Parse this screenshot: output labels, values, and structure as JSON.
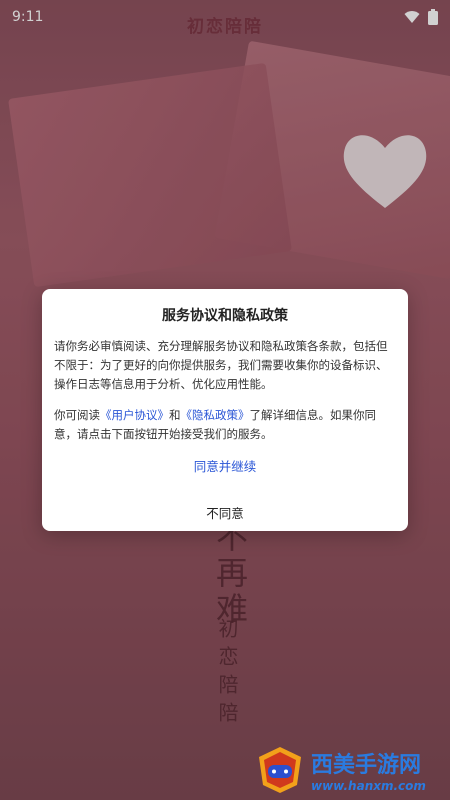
{
  "status_bar": {
    "time": "9:11",
    "icons": [
      "wifi-icon",
      "battery-icon"
    ]
  },
  "app": {
    "title": "初恋陪陪"
  },
  "background": {
    "vertical_text_big": "不再难",
    "vertical_text_small": "初恋陪陪"
  },
  "dialog": {
    "title": "服务协议和隐私政策",
    "paragraph1": "请你务必审慎阅读、充分理解服务协议和隐私政策各条款，包括但不限于：为了更好的向你提供服务，我们需要收集你的设备标识、操作日志等信息用于分析、优化应用性能。",
    "paragraph2_prefix": "你可阅读",
    "link_user_agreement": "《用户协议》",
    "paragraph2_and": "和",
    "link_privacy_policy": "《隐私政策》",
    "paragraph2_suffix": "了解详细信息。如果你同意，请点击下面按钮开始接受我们的服务。",
    "agree_label": "同意并继续",
    "disagree_label": "不同意"
  },
  "watermark": {
    "name": "西美手游网",
    "url": "www.hanxm.com"
  },
  "colors": {
    "link": "#2a56d6",
    "title": "#7e3846",
    "watermark": "#2a7be0"
  }
}
